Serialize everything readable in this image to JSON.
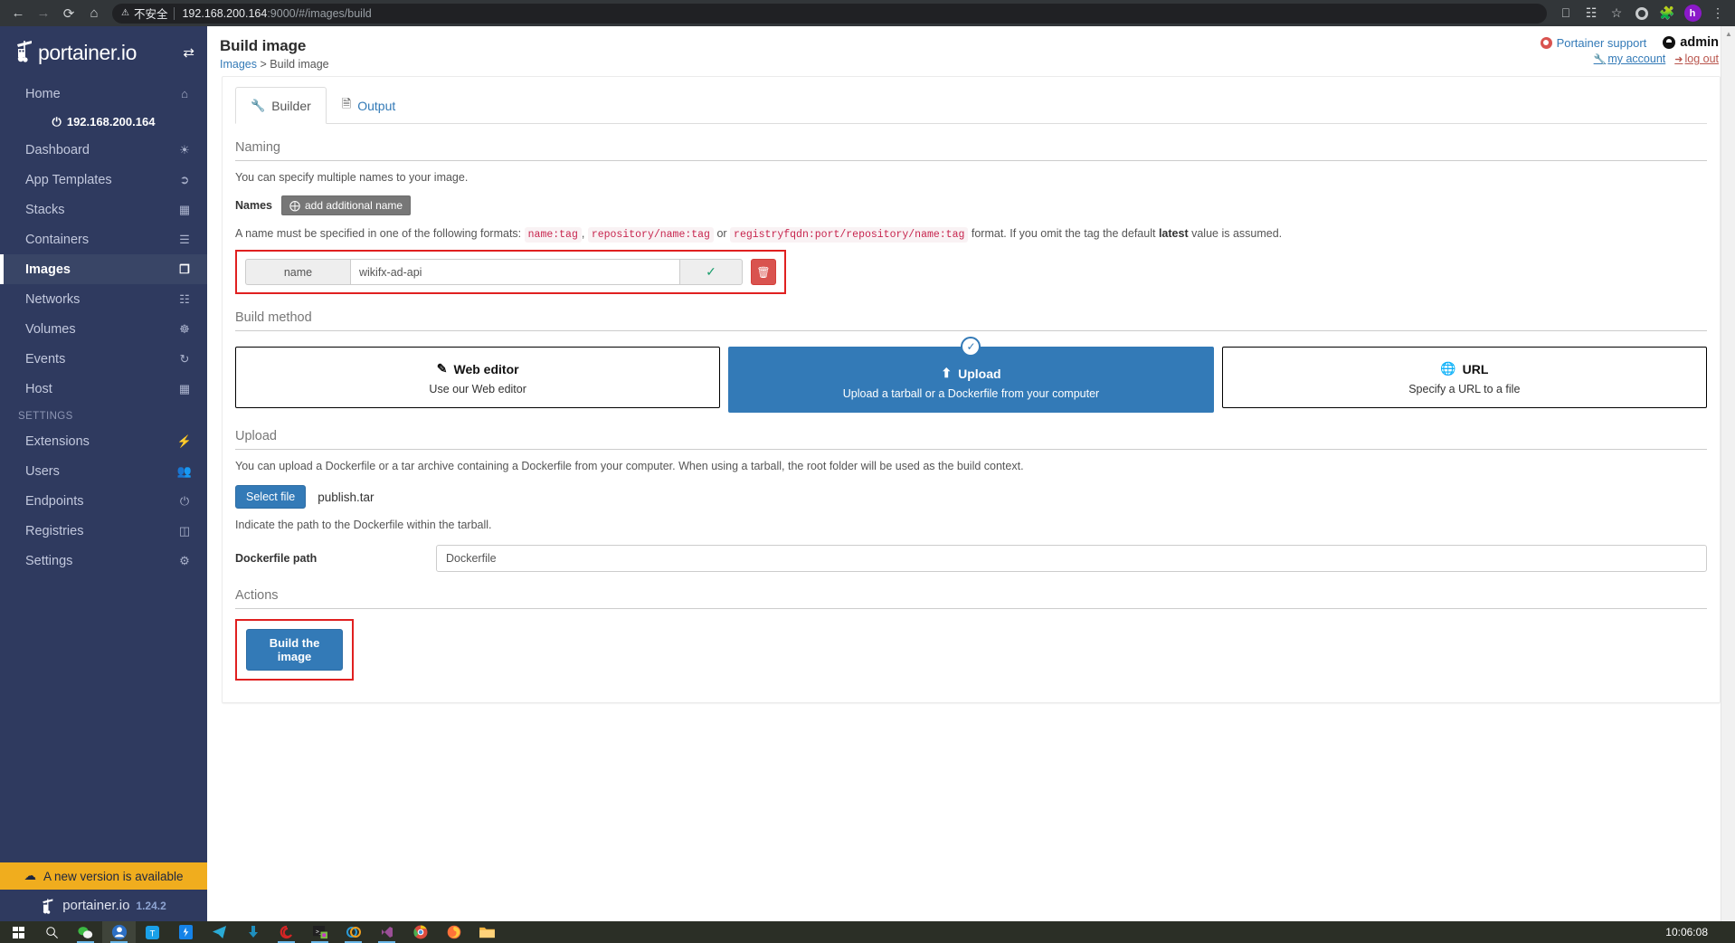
{
  "browser": {
    "back_icon": "arrow-left-icon",
    "forward_icon": "arrow-right-icon",
    "reload_icon": "reload-icon",
    "home_icon": "home-icon",
    "warning_icon": "warning-triangle-icon",
    "insecure_label": "不安全",
    "url_host": "192.168.200.164",
    "url_rest": ":9000/#/images/build",
    "toolbar_icons": [
      "cast-icon",
      "apps-grid-icon",
      "bookmark-star-icon",
      "ring-extension-icon",
      "puzzle-extension-icon",
      "profile-avatar-icon",
      "kebab-menu-icon"
    ],
    "profile_initial": "h"
  },
  "sidebar": {
    "brand": "portainer.io",
    "switch_icon": "endpoint-switch-icon",
    "home": {
      "label": "Home",
      "icon": "home-icon"
    },
    "endpoint": {
      "label": "192.168.200.164",
      "icon": "plug-icon"
    },
    "items": [
      {
        "label": "Dashboard",
        "icon": "dashboard-gauge-icon",
        "active": false
      },
      {
        "label": "App Templates",
        "icon": "rocket-icon",
        "active": false
      },
      {
        "label": "Stacks",
        "icon": "stacks-grid-icon",
        "active": false
      },
      {
        "label": "Containers",
        "icon": "containers-list-icon",
        "active": false
      },
      {
        "label": "Images",
        "icon": "images-layers-icon",
        "active": true
      },
      {
        "label": "Networks",
        "icon": "network-sitemap-icon",
        "active": false
      },
      {
        "label": "Volumes",
        "icon": "volumes-cubes-icon",
        "active": false
      },
      {
        "label": "Events",
        "icon": "history-clock-icon",
        "active": false
      },
      {
        "label": "Host",
        "icon": "host-grid-icon",
        "active": false
      }
    ],
    "settings_heading": "SETTINGS",
    "settings_items": [
      {
        "label": "Extensions",
        "icon": "bolt-icon"
      },
      {
        "label": "Users",
        "icon": "users-icon"
      },
      {
        "label": "Endpoints",
        "icon": "plug-icon"
      },
      {
        "label": "Registries",
        "icon": "database-icon"
      },
      {
        "label": "Settings",
        "icon": "gears-icon"
      }
    ],
    "update_banner": {
      "label": "A new version is available",
      "icon": "cloud-download-icon"
    },
    "footer_brand": "portainer.io",
    "version": "1.24.2"
  },
  "header": {
    "title": "Build image",
    "breadcrumb_root": "Images",
    "breadcrumb_sep": ">",
    "breadcrumb_current": "Build image",
    "support_label": "Portainer support",
    "support_icon": "life-ring-icon",
    "user_label": "admin",
    "user_icon": "user-circle-icon",
    "my_account_label": "my account",
    "my_account_icon": "wrench-icon",
    "logout_label": "log out",
    "logout_icon": "sign-out-icon"
  },
  "tabs": [
    {
      "label": "Builder",
      "icon": "wrench-icon",
      "active": true
    },
    {
      "label": "Output",
      "icon": "file-text-icon",
      "active": false
    }
  ],
  "naming": {
    "section_title": "Naming",
    "helper": "You can specify multiple names to your image.",
    "names_label": "Names",
    "add_button": "add additional name",
    "add_icon": "plus-circle-icon",
    "format_prefix": "A name must be specified in one of the following formats:",
    "format_1": "name:tag",
    "format_comma": ",",
    "format_2": "repository/name:tag",
    "format_or": "or",
    "format_3": "registryfqdn:port/repository/name:tag",
    "format_suffix_a": "format. If you omit the tag the default",
    "format_bold": "latest",
    "format_suffix_b": "value is assumed.",
    "name_addon": "name",
    "name_value": "wikifx-ad-api",
    "valid_icon": "check-icon",
    "delete_icon": "trash-icon"
  },
  "build_method": {
    "section_title": "Build method",
    "options": [
      {
        "title": "Web editor",
        "subtitle": "Use our Web editor",
        "icon": "edit-pencil-icon",
        "selected": false
      },
      {
        "title": "Upload",
        "subtitle": "Upload a tarball or a Dockerfile from your computer",
        "icon": "upload-icon",
        "selected": true
      },
      {
        "title": "URL",
        "subtitle": "Specify a URL to a file",
        "icon": "globe-icon",
        "selected": false
      }
    ],
    "selected_badge_icon": "check-circle-icon"
  },
  "upload": {
    "section_title": "Upload",
    "helper": "You can upload a Dockerfile or a tar archive containing a Dockerfile from your computer. When using a tarball, the root folder will be used as the build context.",
    "select_file_button": "Select file",
    "selected_file": "publish.tar",
    "path_helper": "Indicate the path to the Dockerfile within the tarball.",
    "dockerfile_path_label": "Dockerfile path",
    "dockerfile_path_value": "Dockerfile"
  },
  "actions": {
    "section_title": "Actions",
    "build_button": "Build the image"
  },
  "taskbar": {
    "start_icon": "windows-start-icon",
    "search_icon": "search-icon",
    "apps": [
      "wechat-icon",
      "browser-icon",
      "tim-icon",
      "dingtalk-icon",
      "telegram-icon",
      "download-manager-icon",
      "navicat-icon",
      "terminal-icon",
      "app-icon",
      "visual-studio-icon",
      "chrome-icon",
      "firefox-icon",
      "file-explorer-icon"
    ],
    "clock": "10:06:08"
  },
  "colors": {
    "sidebar_bg": "#2f3a5f",
    "primary_blue": "#337ab7",
    "danger_red": "#d9534f",
    "highlight_red": "#e02020",
    "warning_orange": "#f0ad1e",
    "link_blue": "#337ab7"
  }
}
